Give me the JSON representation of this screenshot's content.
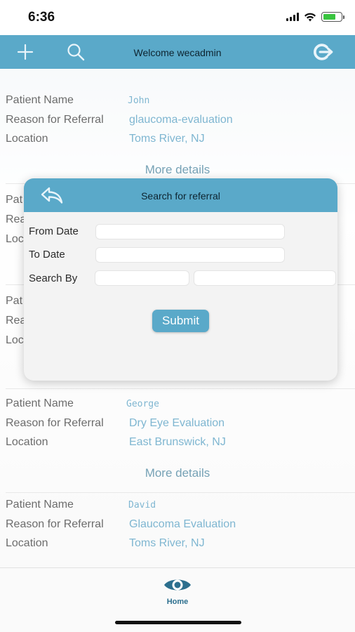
{
  "status_bar": {
    "time": "6:36"
  },
  "header": {
    "welcome_text": "Welcome wecadmin",
    "icons": [
      "plus-icon",
      "search-icon",
      "logout-icon"
    ],
    "color": "#5aa9c9"
  },
  "labels": {
    "patient_name": "Patient Name",
    "reason": "Reason for Referral",
    "location": "Location",
    "more_details": "More details"
  },
  "referrals": [
    {
      "patient_name": "John",
      "reason": "glaucoma-evaluation",
      "location": "Toms River, NJ"
    },
    {
      "patient_name": "George",
      "reason": "Dry Eye Evaluation",
      "location": "East Brunswick, NJ"
    },
    {
      "patient_name": "David",
      "reason": "Glaucoma Evaluation",
      "location": "Toms River, NJ"
    }
  ],
  "partial_rows": [
    "Pat",
    "Rea",
    "Loc"
  ],
  "modal": {
    "title": "Search for referral",
    "from_date_label": "From Date",
    "to_date_label": "To Date",
    "search_by_label": "Search By",
    "from_date_value": "",
    "to_date_value": "",
    "search_by_field_value": "",
    "search_by_query_value": "",
    "submit_label": "Submit"
  },
  "tab_bar": {
    "home_label": "Home",
    "accent": "#2c6f8e"
  },
  "colors": {
    "value_text": "#3a8fb8",
    "link_text": "#2c6f8e"
  }
}
